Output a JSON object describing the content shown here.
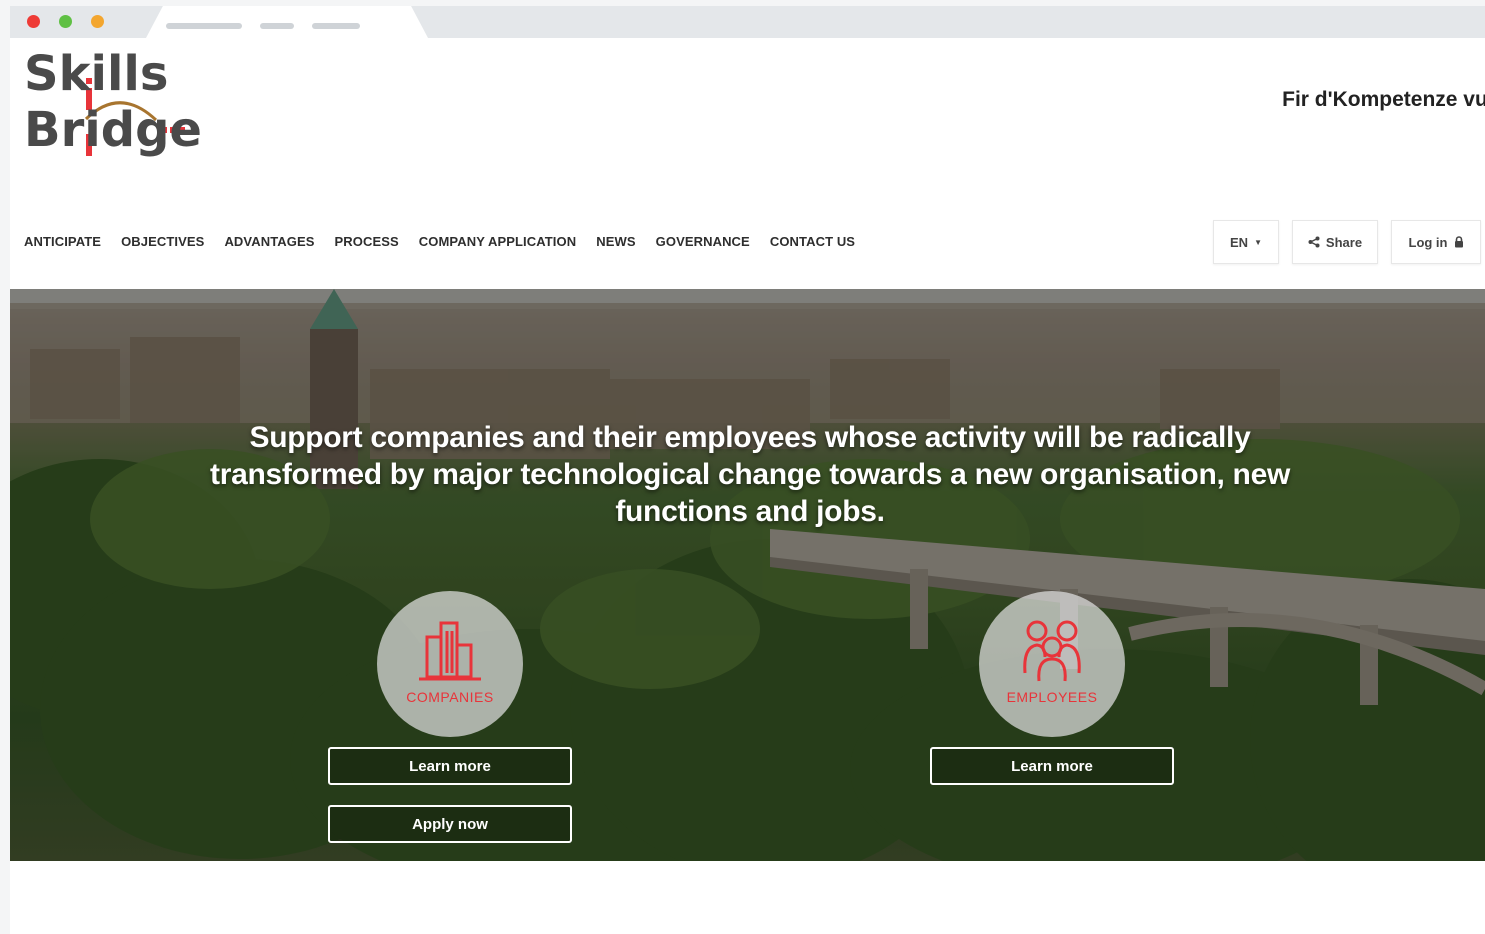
{
  "logo": {
    "line1": "Skills",
    "line2": "Bridge"
  },
  "tagline": "Fir d'Kompetenze vu muer",
  "nav": {
    "items": [
      "ANTICIPATE",
      "OBJECTIVES",
      "ADVANTAGES",
      "PROCESS",
      "COMPANY APPLICATION",
      "NEWS",
      "GOVERNANCE",
      "CONTACT US"
    ],
    "language": "EN",
    "share": "Share",
    "login": "Log in"
  },
  "hero": {
    "title": "Support companies and their employees whose activity will be radically transformed by major technological change towards a new organisation, new functions and jobs.",
    "companies": {
      "label": "COMPANIES",
      "learn_more": "Learn more",
      "apply_now": "Apply now"
    },
    "employees": {
      "label": "EMPLOYEES",
      "learn_more": "Learn more"
    }
  },
  "colors": {
    "accent": "#e8343a",
    "logo_text": "#4a4a4a",
    "nav_text": "#2e2e2e"
  }
}
